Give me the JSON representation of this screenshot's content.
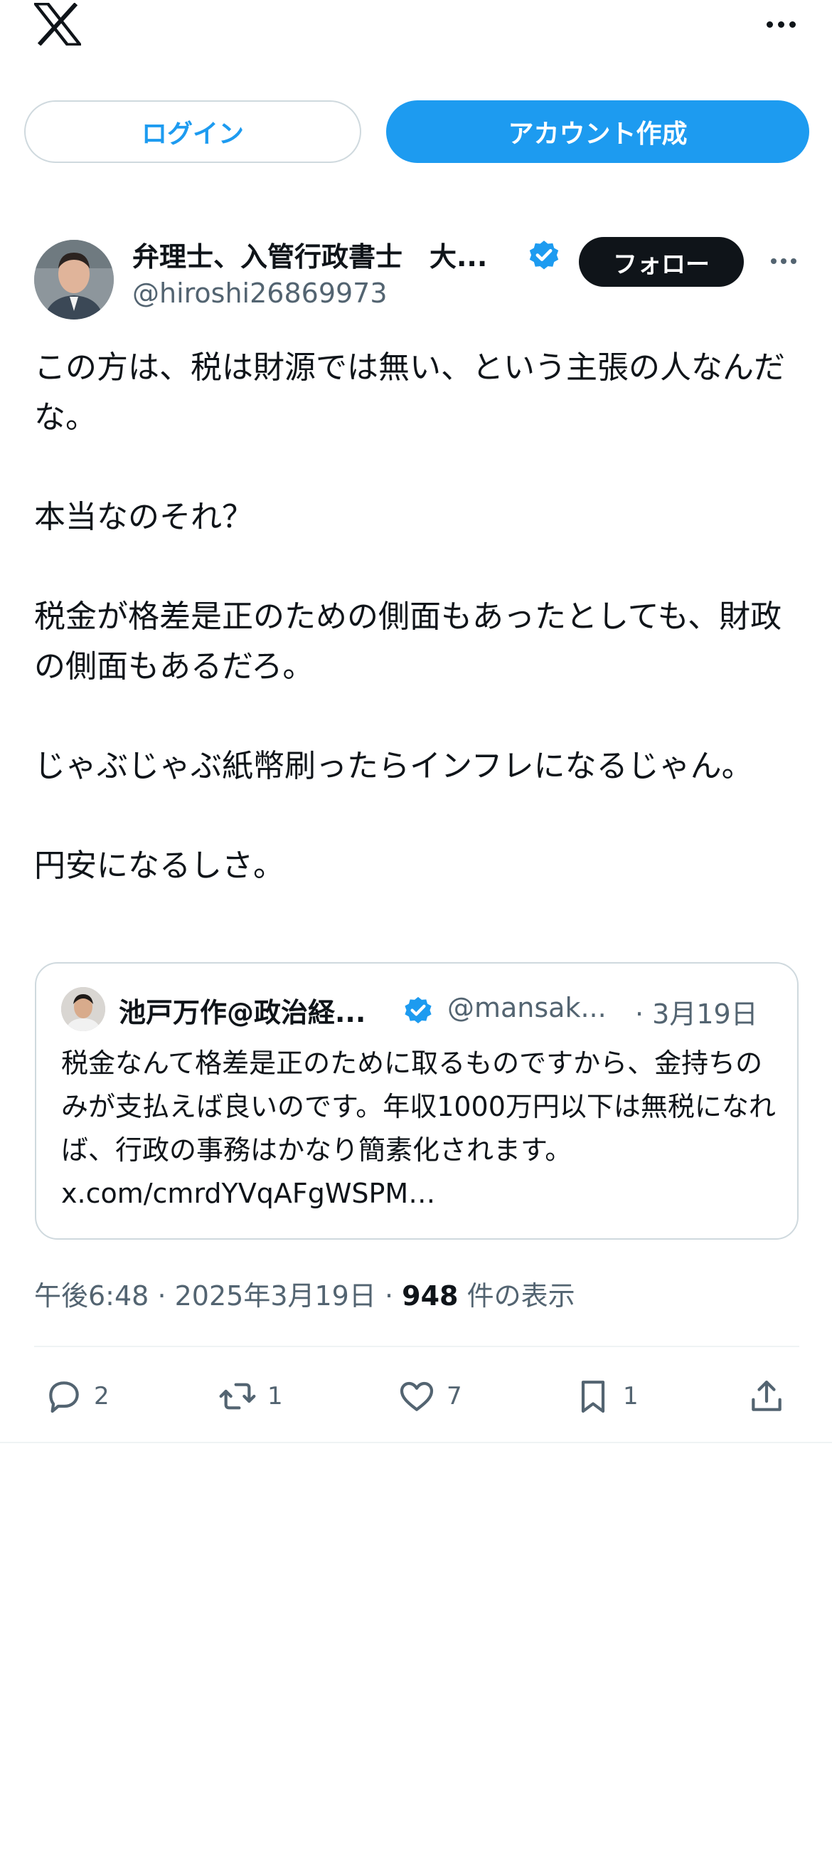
{
  "header": {
    "logo_icon": "x-logo-icon",
    "more_icon": "more-horizontal-icon"
  },
  "buttons": {
    "login": "ログイン",
    "signup": "アカウント作成",
    "follow": "フォロー"
  },
  "tweet": {
    "author_name": "弁理士、入管行政書士　大...",
    "handle": "@hiroshi26869973",
    "body": "この方は、税は財源では無い、という主張の人なんだな。\n\n本当なのそれ？\n\n税金が格差是正のための側面もあったとしても、財政の側面もあるだろ。\n\nじゃぶじゃぶ紙幣刷ったらインフレになるじゃん。\n\n円安になるしさ。",
    "time": "午後6:48",
    "date": "2025年3月19日",
    "views_count": "948",
    "views_label": "件の表示",
    "separator": "·"
  },
  "quote": {
    "author_name": "池戸万作@政治経...",
    "handle": "@mansak...",
    "date": "· 3月19日",
    "text": "税金なんて格差是正のために取るものですから、金持ちのみが支払えば良いのです。年収1000万円以下は無税になれば、行政の事務はかなり簡素化されます。 x.com/cmrdYVqAFgWSPM…"
  },
  "actions": {
    "reply": "2",
    "retweet": "1",
    "like": "7",
    "bookmark": "1"
  },
  "colors": {
    "accent": "#1d9bf0",
    "text": "#0f1419",
    "secondary": "#536471",
    "border": "#cfd9de"
  }
}
